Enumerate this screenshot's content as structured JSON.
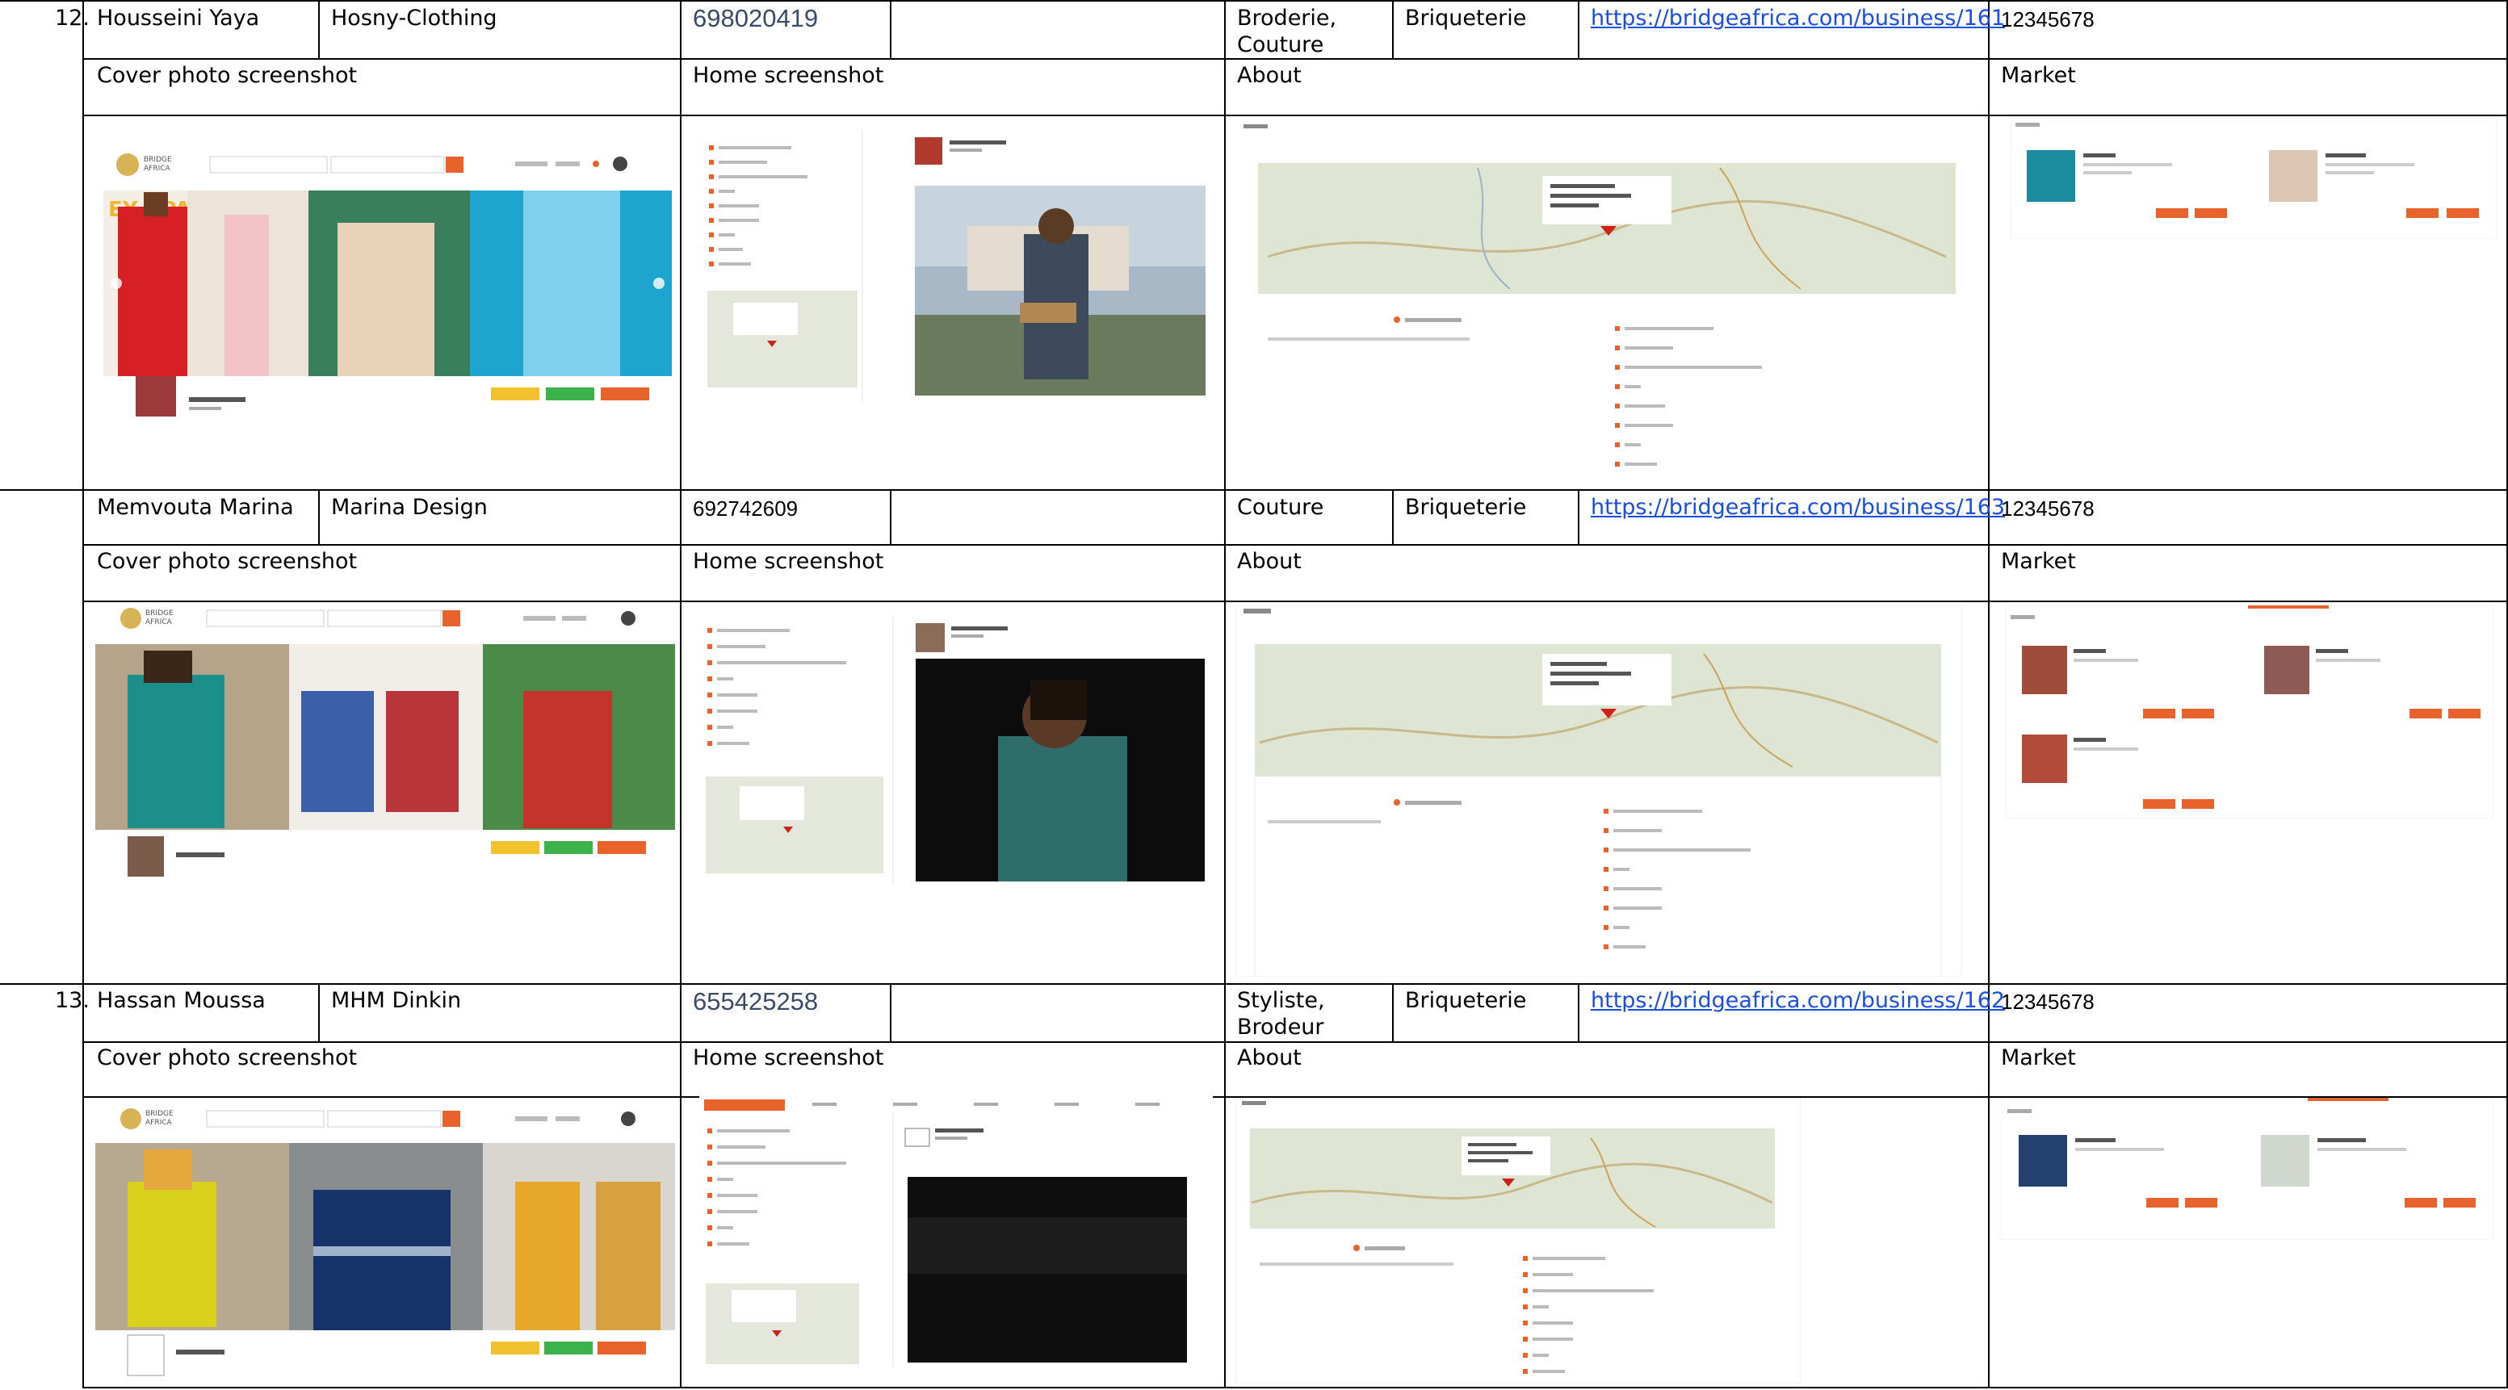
{
  "rows": [
    {
      "number": "12.",
      "name": "Housseini Yaya",
      "business": "Hosny-Clothing",
      "phone": "698020419",
      "category": "Broderie, Couture",
      "location": "Briqueterie",
      "url": "https://bridgeafrica.com/business/161",
      "code": "12345678",
      "labels": {
        "cover": "Cover photo screenshot",
        "home": "Home screenshot",
        "about": "About",
        "market": "Market"
      }
    },
    {
      "number": "",
      "name": "Memvouta Marina",
      "business": "Marina Design",
      "phone": "692742609",
      "category": "Couture",
      "location": "Briqueterie",
      "url": "https://bridgeafrica.com/business/163",
      "code": "12345678",
      "labels": {
        "cover": "Cover photo screenshot",
        "home": "Home screenshot",
        "about": "About",
        "market": "Market"
      }
    },
    {
      "number": "13.",
      "name": "Hassan Moussa",
      "business": "MHM Dinkin",
      "phone": "655425258",
      "category": "Styliste, Brodeur",
      "location": "Briqueterie",
      "url": "https://bridgeafrica.com/business/162",
      "code": "12345678",
      "labels": {
        "cover": "Cover photo screenshot",
        "home": "Home screenshot",
        "about": "About",
        "market": "Market"
      }
    }
  ],
  "screenshots": {
    "logo_text": [
      "BRIDGE",
      "AFRICA"
    ],
    "colors": {
      "accent": "#e8632b",
      "map": "#dfe5d3",
      "road": "#c9a45a",
      "pin": "#d0201a",
      "button_yellow": "#f2c12e",
      "button_green": "#3bb34a"
    }
  }
}
